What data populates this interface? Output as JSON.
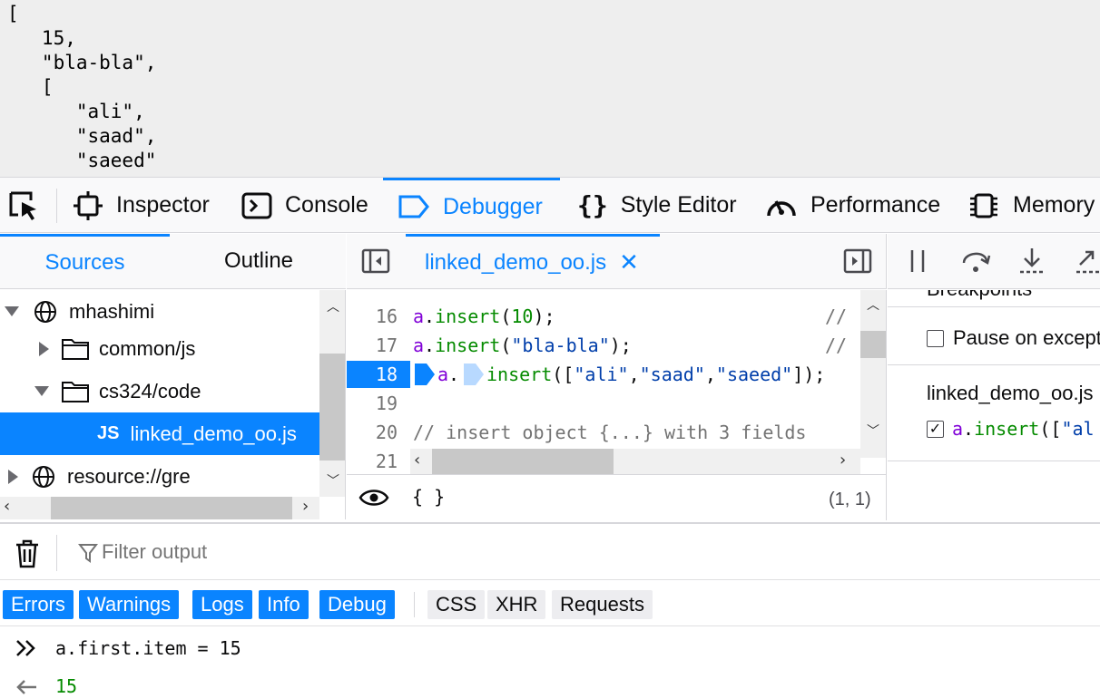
{
  "page": {
    "lines": [
      "[",
      "   15,",
      "   \"bla-bla\",",
      "   [",
      "      \"ali\",",
      "      \"saad\",",
      "      \"saeed\""
    ]
  },
  "toolbar": {
    "tabs": [
      {
        "label": "Inspector",
        "icon": "inspector-icon"
      },
      {
        "label": "Console",
        "icon": "console-icon"
      },
      {
        "label": "Debugger",
        "icon": "debugger-icon",
        "active": true
      },
      {
        "label": "Style Editor",
        "icon": "style-editor-icon"
      },
      {
        "label": "Performance",
        "icon": "performance-icon"
      },
      {
        "label": "Memory",
        "icon": "memory-icon"
      }
    ]
  },
  "sidebar": {
    "tabs": [
      "Sources",
      "Outline"
    ],
    "tree": [
      {
        "label": "mhashimi",
        "kind": "domain",
        "expanded": true
      },
      {
        "label": "common/js",
        "kind": "folder",
        "expanded": false
      },
      {
        "label": "cs324/code",
        "kind": "folder",
        "expanded": true
      },
      {
        "label": "linked_demo_oo.js",
        "kind": "file",
        "badge": "JS",
        "selected": true
      },
      {
        "label": "resource://gre",
        "kind": "domain",
        "expanded": false
      }
    ]
  },
  "editor": {
    "tab_label": "linked_demo_oo.js",
    "lines": [
      {
        "num": "16",
        "code": "a.insert(10);",
        "comment": "//"
      },
      {
        "num": "17",
        "code": "a.insert(\"bla-bla\");",
        "comment": "//"
      },
      {
        "num": "18",
        "code": "a.insert([\"ali\",\"saad\",\"saeed\"]);",
        "breakpoint": true
      },
      {
        "num": "19",
        "code": ""
      },
      {
        "num": "20",
        "code": "// insert object {...} with 3 fields"
      },
      {
        "num": "21",
        "code": ""
      }
    ],
    "footer": {
      "pretty": "{ }",
      "position": "(1, 1)"
    }
  },
  "right_pane": {
    "breakpoints_heading": "Breakpoints",
    "pause_on_exceptions": "Pause on exceptions",
    "file_label": "linked_demo_oo.js",
    "breakpoint_text": "a.insert([\"ali\""
  },
  "console": {
    "filter_placeholder": "Filter output",
    "levels": [
      {
        "label": "Errors",
        "on": true
      },
      {
        "label": "Warnings",
        "on": true
      },
      {
        "label": "Logs",
        "on": true
      },
      {
        "label": "Info",
        "on": true
      },
      {
        "label": "Debug",
        "on": true
      }
    ],
    "types": [
      "CSS",
      "XHR",
      "Requests"
    ],
    "input": "a.first.item = 15",
    "output": "15"
  },
  "colors": {
    "accent": "#0a84ff",
    "number": "#058b00",
    "string": "#003eaa",
    "variable": "#8000d7"
  }
}
